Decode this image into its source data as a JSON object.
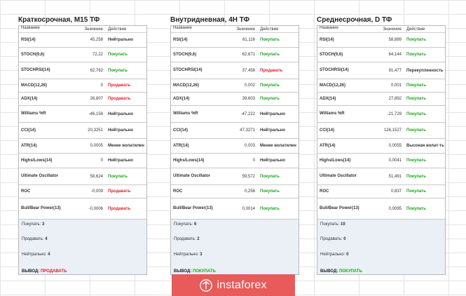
{
  "headers": {
    "name": "Название",
    "value": "Значение",
    "action": "Действие"
  },
  "colors": {
    "buy": "#1aa51a",
    "sell": "#e0202c",
    "summary_bg": "#eaf0f6",
    "logo_bg": "#e95a5a"
  },
  "panels": [
    {
      "title": "Краткосрочная, М15 ТФ",
      "rows": [
        {
          "name": "RSI(14)",
          "value": "45,258",
          "action": "Нейтрально",
          "kind": "neutral"
        },
        {
          "name": "STOCH(9,6)",
          "value": "72,22",
          "action": "Покупать",
          "kind": "buy"
        },
        {
          "name": "STOCHRSI(14)",
          "value": "62,762",
          "action": "Покупать",
          "kind": "buy"
        },
        {
          "name": "MACD(12,26)",
          "value": "0",
          "action": "Продавать",
          "kind": "sell"
        },
        {
          "name": "ADX(14)",
          "value": "26,807",
          "action": "Продавать",
          "kind": "sell"
        },
        {
          "name": "Williams %R",
          "value": "-46,158",
          "action": "Нейтрально",
          "kind": "neutral"
        },
        {
          "name": "CCI(14)",
          "value": "20,3251",
          "action": "Нейтрально",
          "kind": "neutral"
        },
        {
          "name": "ATR(14)",
          "value": "0,0005",
          "action": "Менее волатилен",
          "kind": "less"
        },
        {
          "name": "Highs/Lows(14)",
          "value": "0",
          "action": "Нейтрально",
          "kind": "neutral"
        },
        {
          "name": "Ultimate Oscillator",
          "value": "58,624",
          "action": "Покупать",
          "kind": "buy"
        },
        {
          "name": "ROC",
          "value": "-0,009",
          "action": "Продавать",
          "kind": "sell"
        },
        {
          "name": "Bull/Bear Power(13)",
          "value": "-0,0006",
          "action": "Продавать",
          "kind": "sell"
        }
      ],
      "summary": {
        "buy_label": "Покупать:",
        "buy_count": "3",
        "sell_label": "Продавать:",
        "sell_count": "4",
        "neutral_label": "Нейтрально:",
        "neutral_count": "4",
        "verdict_label": "ВЫВОД:",
        "verdict": "ПРОДАВАТЬ",
        "verdict_kind": "sell"
      }
    },
    {
      "title": "Внутридневная, 4Н ТФ",
      "rows": [
        {
          "name": "RSI(14)",
          "value": "61,116",
          "action": "Покупать",
          "kind": "buy"
        },
        {
          "name": "STOCH(9,6)",
          "value": "62,671",
          "action": "Покупать",
          "kind": "buy"
        },
        {
          "name": "STOCHRSI(14)",
          "value": "37,458",
          "action": "Продавать",
          "kind": "sell"
        },
        {
          "name": "MACD(12,26)",
          "value": "0,002",
          "action": "Покупать",
          "kind": "buy"
        },
        {
          "name": "ADX(14)",
          "value": "39,603",
          "action": "Покупать",
          "kind": "buy"
        },
        {
          "name": "Williams %R",
          "value": "-47,222",
          "action": "Нейтрально",
          "kind": "neutral"
        },
        {
          "name": "CCI(14)",
          "value": "47,3271",
          "action": "Нейтрально",
          "kind": "neutral"
        },
        {
          "name": "ATR(14)",
          "value": "0,003",
          "action": "Менее волатилен",
          "kind": "less"
        },
        {
          "name": "Highs/Lows(14)",
          "value": "0",
          "action": "Нейтрально",
          "kind": "neutral"
        },
        {
          "name": "Ultimate Oscillator",
          "value": "59,572",
          "action": "Покупать",
          "kind": "buy"
        },
        {
          "name": "ROC",
          "value": "0,258",
          "action": "Покупать",
          "kind": "buy"
        },
        {
          "name": "Bull/Bear Power(13)",
          "value": "0,0014",
          "action": "Покупать",
          "kind": "buy"
        }
      ],
      "summary": {
        "buy_label": "Покупать:",
        "buy_count": "6",
        "sell_label": "Продавать:",
        "sell_count": "2",
        "neutral_label": "Нейтрально:",
        "neutral_count": "3",
        "verdict_label": "ВЫВОД:",
        "verdict": "ПОКУПАТЬ",
        "verdict_kind": "buy"
      }
    },
    {
      "title": "Среднесрочная, D ТФ",
      "rows": [
        {
          "name": "RSI(14)",
          "value": "58,889",
          "action": "Покупать",
          "kind": "buy"
        },
        {
          "name": "STOCH(9,6)",
          "value": "64,144",
          "action": "Покупать",
          "kind": "buy"
        },
        {
          "name": "STOCHRSI(14)",
          "value": "91,477",
          "action": "Перекупленность",
          "kind": "overb"
        },
        {
          "name": "MACD(12,26)",
          "value": "0,001",
          "action": "Покупать",
          "kind": "buy"
        },
        {
          "name": "ADX(14)",
          "value": "27,892",
          "action": "Покупать",
          "kind": "buy"
        },
        {
          "name": "Williams %R",
          "value": "-21,729",
          "action": "Покупать",
          "kind": "buy"
        },
        {
          "name": "CCI(14)",
          "value": "126,1527",
          "action": "Покупать",
          "kind": "buy"
        },
        {
          "name": "ATR(14)",
          "value": "0,0055",
          "action": "Высокая волат-ть",
          "kind": "highv"
        },
        {
          "name": "Highs/Lows(14)",
          "value": "0,0041",
          "action": "Покупать",
          "kind": "buy"
        },
        {
          "name": "Ultimate Oscillator",
          "value": "51,491",
          "action": "Покупать",
          "kind": "buy"
        },
        {
          "name": "ROC",
          "value": "0,837",
          "action": "Покупать",
          "kind": "buy"
        },
        {
          "name": "Bull/Bear Power(13)",
          "value": "0,0095",
          "action": "Покупать",
          "kind": "buy"
        }
      ],
      "summary": {
        "buy_label": "Покупать:",
        "buy_count": "10",
        "sell_label": "Продавать:",
        "sell_count": "0",
        "neutral_label": "Нейтрально:",
        "neutral_count": "0",
        "verdict_label": "ВЫВОД:",
        "verdict": "ПОКУПАТЬ",
        "verdict_kind": "buy"
      }
    }
  ],
  "logo": {
    "text": "instaforex",
    "icon": "instaforex-logo-icon"
  }
}
